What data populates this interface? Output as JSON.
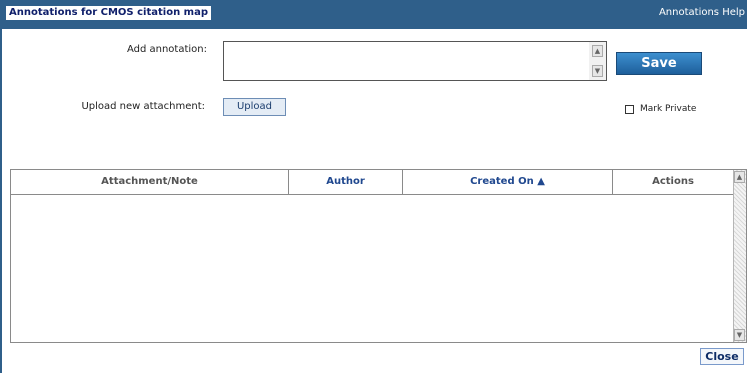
{
  "window": {
    "title": "Annotations for CMOS citation map",
    "help_link": "Annotations Help"
  },
  "form": {
    "annotation_label": "Add annotation:",
    "annotation_value": "",
    "upload_label": "Upload new attachment:",
    "upload_button": "Upload",
    "save_button": "Save",
    "mark_private_label": "Mark Private",
    "mark_private_checked": false
  },
  "grid": {
    "columns": [
      "Attachment/Note",
      "Author",
      "Created On ▲",
      "Actions"
    ],
    "sort_column": "Created On",
    "sort_direction": "ascending",
    "rows": []
  },
  "footer": {
    "close_button": "Close"
  },
  "colors": {
    "titlebar": "#2f5f8a",
    "title_text": "#10206b",
    "save_button": "#1e5f9b",
    "header_link": "#20488f"
  },
  "icons": {
    "scroll_up": "arrow-up-icon",
    "scroll_down": "arrow-down-icon",
    "checkbox": "checkbox-icon"
  }
}
